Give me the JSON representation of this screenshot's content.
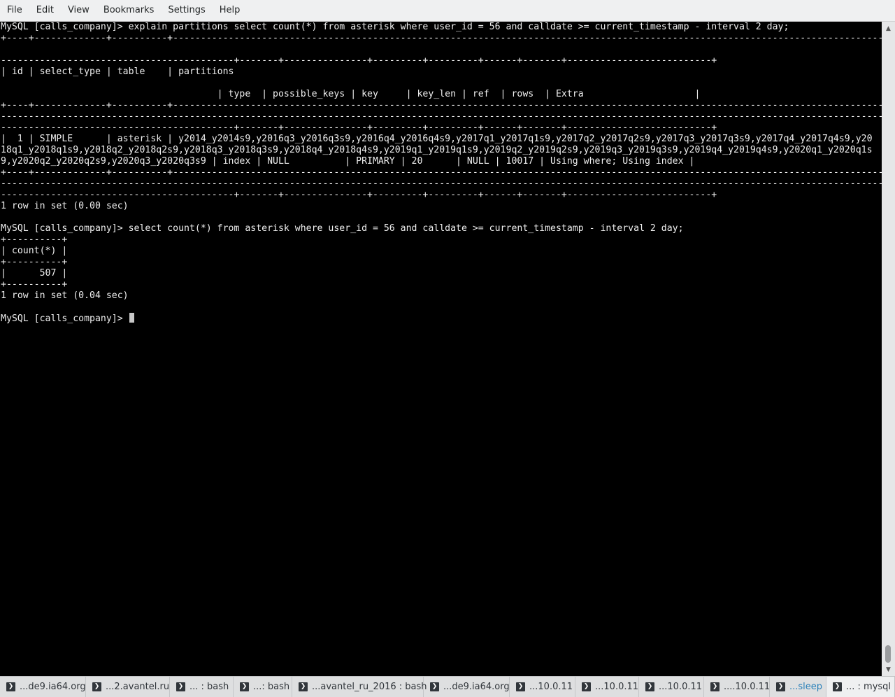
{
  "menubar": {
    "file": "File",
    "edit": "Edit",
    "view": "View",
    "bookmarks": "Bookmarks",
    "settings": "Settings",
    "help": "Help"
  },
  "terminal": {
    "lines": [
      "MySQL [calls_company]> explain partitions select count(*) from asterisk where user_id = 56 and calldate >= current_timestamp - interval 2 day;",
      "+----+-------------+----------+-------------------------------------------------------------------------------------------------------------------------------------------------------------------------------------",
      "------------------------------------------+-------+---------------+---------+---------+------+-------+--------------------------+",
      "| id | select_type | table    | partitions",
      "",
      "                                       | type  | possible_keys | key     | key_len | ref  | rows  | Extra                    |",
      "+----+-------------+----------+-------------------------------------------------------------------------------------------------------------------------------------------------------------------------------------",
      "-------------------------------------------------------------------------------------------------------------------------------------------------------------------------------------------------------------",
      "------------------------------------------+-------+---------------+---------+---------+------+-------+--------------------------+",
      "|  1 | SIMPLE      | asterisk | y2014_y2014s9,y2016q3_y2016q3s9,y2016q4_y2016q4s9,y2017q1_y2017q1s9,y2017q2_y2017q2s9,y2017q3_y2017q3s9,y2017q4_y2017q4s9,y20",
      "18q1_y2018q1s9,y2018q2_y2018q2s9,y2018q3_y2018q3s9,y2018q4_y2018q4s9,y2019q1_y2019q1s9,y2019q2_y2019q2s9,y2019q3_y2019q3s9,y2019q4_y2019q4s9,y2020q1_y2020q1s",
      "9,y2020q2_y2020q2s9,y2020q3_y2020q3s9 | index | NULL          | PRIMARY | 20      | NULL | 10017 | Using where; Using index |",
      "+----+-------------+----------+-------------------------------------------------------------------------------------------------------------------------------------------------------------------------------------",
      "-------------------------------------------------------------------------------------------------------------------------------------------------------------------------------------------------------------",
      "------------------------------------------+-------+---------------+---------+---------+------+-------+--------------------------+",
      "1 row in set (0.00 sec)",
      "",
      "MySQL [calls_company]> select count(*) from asterisk where user_id = 56 and calldate >= current_timestamp - interval 2 day;",
      "+----------+",
      "| count(*) |",
      "+----------+",
      "|      507 |",
      "+----------+",
      "1 row in set (0.04 sec)",
      "",
      "MySQL [calls_company]> "
    ]
  },
  "tabs": [
    {
      "label": "...de9.ia64.org"
    },
    {
      "label": "...2.avantel.ru"
    },
    {
      "label": "... : bash"
    },
    {
      "label": "...: bash"
    },
    {
      "label": "...avantel_ru_2016 : bash"
    },
    {
      "label": "...de9.ia64.org"
    },
    {
      "label": "...10.0.11"
    },
    {
      "label": "...10.0.11"
    },
    {
      "label": "...10.0.11"
    },
    {
      "label": "....10.0.11"
    },
    {
      "label": "...sleep"
    },
    {
      "label": "... : mysql"
    }
  ]
}
